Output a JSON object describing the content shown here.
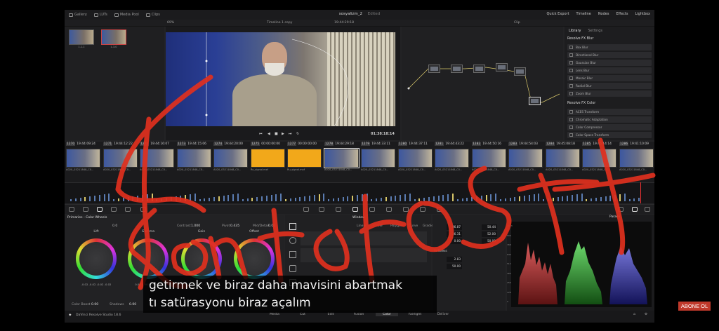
{
  "app": {
    "project_name": "sosyalizm_2",
    "project_status": "Edited",
    "version_label": "DaVinci Resolve Studio 18.6"
  },
  "topbar": {
    "left_items": [
      "Gallery",
      "LUTs",
      "Media Pool",
      "Clips"
    ],
    "right_items": [
      "Quick Export",
      "Timeline",
      "Nodes",
      "Effects",
      "Lightbox"
    ]
  },
  "viewer": {
    "zoom": "69%",
    "timeline_name": "Timeline 1 copy",
    "timecode": "19:44:29:18",
    "playhead_timecode": "01:38:18:14",
    "clip_menu": "Clip"
  },
  "gallery": {
    "stills": [
      "1.1.1",
      "1.3.0"
    ]
  },
  "library": {
    "tabs": [
      "Library",
      "Settings"
    ],
    "sections": [
      {
        "title": "Resolve FX Blur",
        "items": [
          "Box Blur",
          "Directional Blur",
          "Gaussian Blur",
          "Lens Blur",
          "Mosaic Blur",
          "Radial Blur",
          "Zoom Blur"
        ]
      },
      {
        "title": "Resolve FX Color",
        "items": [
          "ACES Transform",
          "Chromatic Adaptation",
          "Color Compressor",
          "Color Space Transform"
        ]
      }
    ]
  },
  "timeline": {
    "clips": [
      {
        "num": "1270",
        "tc": "19:44:09:24",
        "name": "A020_03211848_C0...",
        "kind": "video"
      },
      {
        "num": "1271",
        "tc": "19:44:12:22",
        "name": "A020_03211848_C0...",
        "kind": "video"
      },
      {
        "num": "1272",
        "tc": "19:44:16:07",
        "name": "A020_03211848_C0...",
        "kind": "video"
      },
      {
        "num": "1273",
        "tc": "19:44:15:06",
        "name": "A020_03211848_C0...",
        "kind": "video"
      },
      {
        "num": "1274",
        "tc": "19:44:20:00",
        "name": "A020_03211848_C0...",
        "kind": "video"
      },
      {
        "num": "1275",
        "tc": "00:00:00:00",
        "name": "Ru_signal.mxf",
        "kind": "orange"
      },
      {
        "num": "1277",
        "tc": "00:00:00:00",
        "name": "Ru_signal.mxf",
        "kind": "orange"
      },
      {
        "num": "1278",
        "tc": "19:44:29:18",
        "name": "A020_03211848_C0...",
        "kind": "video",
        "selected": true
      },
      {
        "num": "1279",
        "tc": "19:44:33:11",
        "name": "A020_03211848_C0...",
        "kind": "video"
      },
      {
        "num": "1280",
        "tc": "19:44:37:11",
        "name": "A020_03211848_C0...",
        "kind": "video"
      },
      {
        "num": "1281",
        "tc": "19:44:43:22",
        "name": "A020_03211848_C0...",
        "kind": "video"
      },
      {
        "num": "1282",
        "tc": "19:44:50:16",
        "name": "A020_03211848_C0...",
        "kind": "video"
      },
      {
        "num": "1283",
        "tc": "19:44:54:03",
        "name": "A020_03211848_C0...",
        "kind": "video"
      },
      {
        "num": "1284",
        "tc": "19:45:08:18",
        "name": "A020_03211848_C0...",
        "kind": "video"
      },
      {
        "num": "1285",
        "tc": "19:45:14:14",
        "name": "A020_03211848_C0...",
        "kind": "video"
      },
      {
        "num": "1286",
        "tc": "19:41:10:09",
        "name": "A020_03211848_C0...",
        "kind": "video"
      }
    ]
  },
  "primaries": {
    "title": "Primaries - Color Wheels",
    "temp": "0.0",
    "contrast_label": "Contrast",
    "contrast_value": "1.000",
    "pivot_label": "Pivot",
    "pivot_value": "0.435",
    "middetail_label": "Mid/Detail",
    "middetail_value": "0.00",
    "wheels": [
      {
        "name": "Lift",
        "values": "-0.02  -0.02  -0.02  -0.02"
      },
      {
        "name": "Gamma",
        "values": "0.00  0.00  0.00  0.00"
      },
      {
        "name": "Gain",
        "values": "1.00  1.00  1.00  1.00"
      },
      {
        "name": "Offset",
        "values": "25.00  25.00  25.00"
      }
    ],
    "color_boost_label": "Color Boost",
    "color_boost_value": "0.00",
    "shadows_label": "Shadows",
    "shadows_value": "0.00"
  },
  "window_panel": {
    "title": "Window",
    "tools": [
      "Linear",
      "Circle",
      "Polygon",
      "Curve",
      "Gradient"
    ]
  },
  "qualifier": {
    "values": [
      "86.87",
      "36.31",
      "0.00",
      "50.44",
      "52.00",
      "50.00"
    ],
    "softness_label": "Softness",
    "soft_values": [
      "2.83",
      "50.00"
    ]
  },
  "scope": {
    "title": "Parade",
    "ticks": [
      "1023",
      "896",
      "768",
      "640",
      "512",
      "384",
      "256",
      "128",
      "0"
    ]
  },
  "pages": [
    "Media",
    "Cut",
    "Edit",
    "Fusion",
    "Color",
    "Fairlight",
    "Deliver"
  ],
  "active_page": "Color",
  "subtitle": {
    "line1": "getirmek ve biraz daha mavisini abartmak",
    "line2": "tı satürasyonu biraz açalım"
  },
  "overlay_badge": "ABONE OL",
  "colors": {
    "scribble": "#e0301e",
    "accent": "#f2a81a",
    "badge": "#c0392b"
  }
}
